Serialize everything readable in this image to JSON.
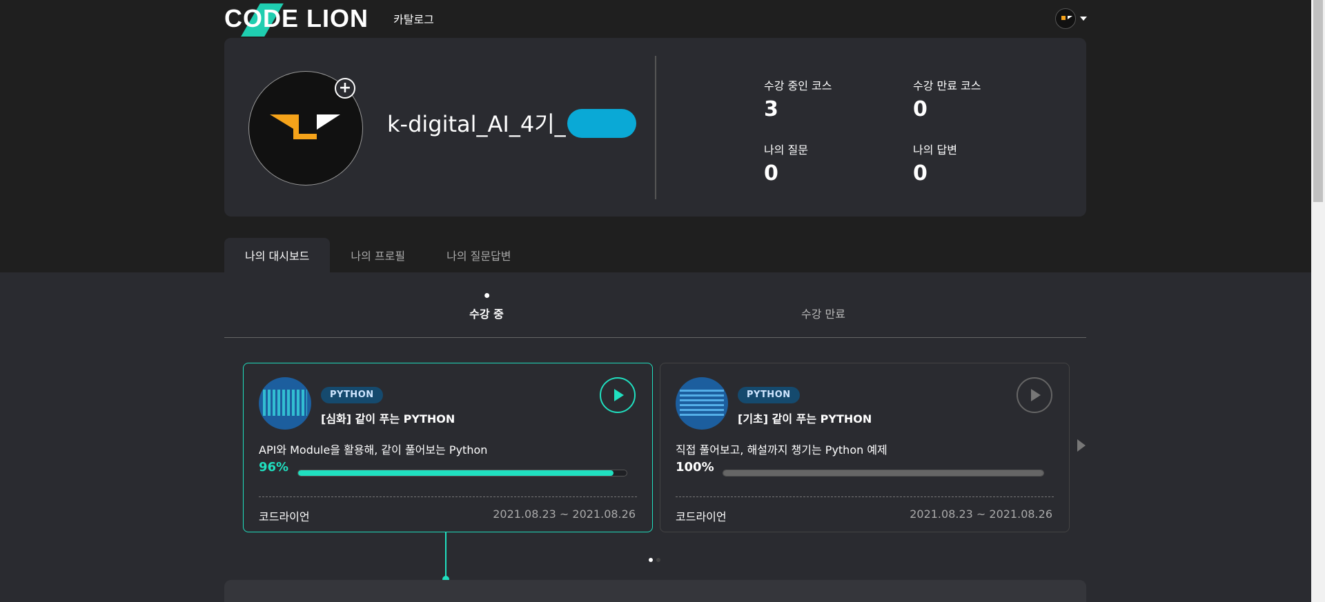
{
  "header": {
    "logo_text": "CODE LION",
    "nav_catalog": "카탈로그"
  },
  "profile": {
    "username": "k-digital_AI_4기_",
    "stats": [
      {
        "label": "수강 중인 코스",
        "value": "3"
      },
      {
        "label": "수강 만료 코스",
        "value": "0"
      },
      {
        "label": "나의 질문",
        "value": "0"
      },
      {
        "label": "나의 답변",
        "value": "0"
      }
    ]
  },
  "tabs": [
    "나의 대시보드",
    "나의 프로필",
    "나의 질문답변"
  ],
  "subtabs": [
    "수강 중",
    "수강 만료"
  ],
  "courses": [
    {
      "badge": "PYTHON",
      "title": "[심화] 같이 푸는 PYTHON",
      "description": "API와 Module을 활용해, 같이 풀어보는 Python",
      "progress_label": "96%",
      "progress": 0.96,
      "provider": "코드라이언",
      "dates": "2021.08.23 ~ 2021.08.26"
    },
    {
      "badge": "PYTHON",
      "title": "[기초] 같이 푸는 PYTHON",
      "description": "직접 풀어보고, 해설까지 챙기는 Python 예제",
      "progress_label": "100%",
      "progress": 1.0,
      "provider": "코드라이언",
      "dates": "2021.08.23 ~ 2021.08.26"
    }
  ],
  "colors": {
    "accent": "#20e0c0",
    "background": "#1f1f1f",
    "card": "#2a2b30",
    "badge": "#154a6e"
  },
  "icons": {
    "add": "plus-circle-icon",
    "play": "play-icon",
    "next": "chevron-right-icon",
    "menu": "caret-down-icon"
  }
}
